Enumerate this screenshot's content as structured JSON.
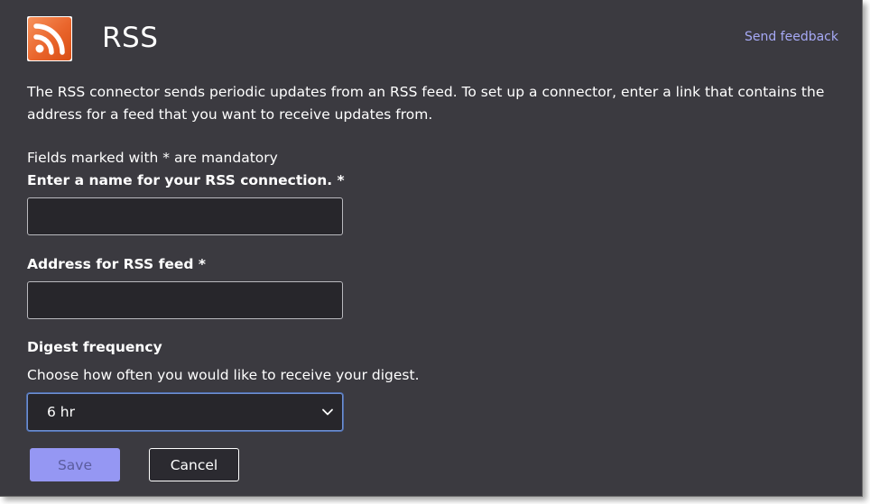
{
  "header": {
    "title": "RSS",
    "logo_icon": "rss-icon",
    "feedback_link": "Send feedback"
  },
  "description": "The RSS connector sends periodic updates from an RSS feed. To set up a connector, enter a link that contains the address for a feed that you want to receive updates from.",
  "form": {
    "mandatory_note": "Fields marked with * are mandatory",
    "name_label": "Enter a name for your RSS connection. *",
    "name_value": "",
    "address_label": "Address for RSS feed *",
    "address_value": "",
    "digest_label": "Digest frequency",
    "digest_helper": "Choose how often you would like to receive your digest.",
    "digest_selected": "6 hr"
  },
  "actions": {
    "save_label": "Save",
    "cancel_label": "Cancel"
  },
  "colors": {
    "panel_bg": "#3b3a40",
    "input_bg": "#27262b",
    "accent": "#9597f3",
    "link": "#a6a9f5",
    "rss_orange": "#e9642b"
  }
}
